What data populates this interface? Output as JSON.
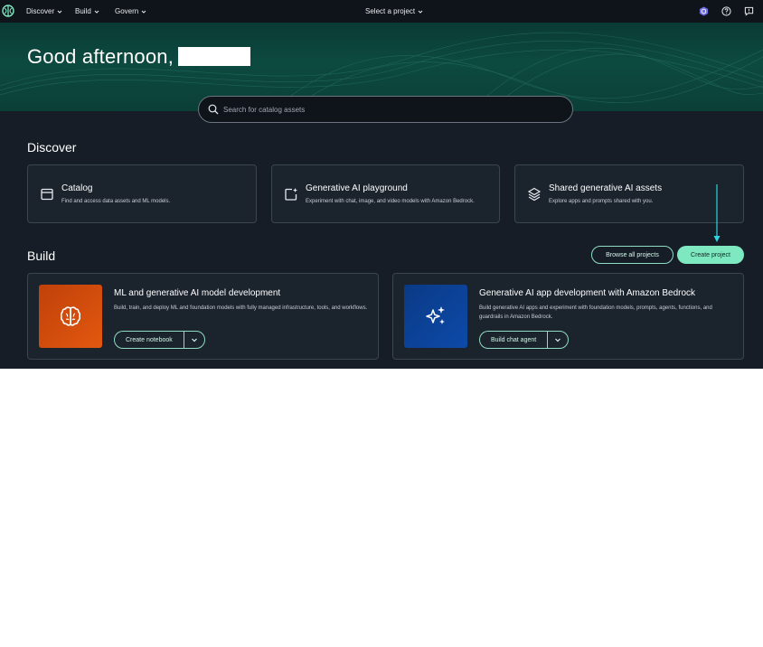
{
  "topbar": {
    "nav": [
      {
        "label": "Discover"
      },
      {
        "label": "Build"
      },
      {
        "label": "Govern"
      }
    ],
    "project_selector": "Select a project",
    "icons": [
      "app-logo-icon",
      "user-badge-icon",
      "help-icon",
      "feedback-icon"
    ]
  },
  "hero": {
    "greeting": "Good afternoon,"
  },
  "search": {
    "placeholder": "Search for catalog assets"
  },
  "discover": {
    "title": "Discover",
    "cards": [
      {
        "icon": "catalog-icon",
        "title": "Catalog",
        "description": "Find and access data assets and ML models."
      },
      {
        "icon": "playground-icon",
        "title": "Generative AI playground",
        "description": "Experiment with chat, image, and video models with Amazon Bedrock."
      },
      {
        "icon": "layers-icon",
        "title": "Shared generative AI assets",
        "description": "Explore apps and prompts shared with you."
      }
    ]
  },
  "build": {
    "title": "Build",
    "browse_label": "Browse all projects",
    "create_label": "Create project",
    "cards": [
      {
        "icon": "brain-icon",
        "title": "ML and generative AI model development",
        "description": "Build, train, and deploy ML and foundation models with fully managed infrastructure, tools, and workflows.",
        "button": "Create notebook",
        "tile_color": "#c8460c"
      },
      {
        "icon": "sparkles-icon",
        "title": "Generative AI app development with Amazon Bedrock",
        "description": "Build generative AI apps and experiment with foundation models, prompts, agents, functions, and guardrails in Amazon Bedrock.",
        "button": "Build chat agent",
        "tile_color": "#0b3f8c"
      }
    ]
  },
  "colors": {
    "background": "#161d26",
    "topbar": "#0f141a",
    "accent": "#7ee8c0",
    "annotation_arrow": "#2fd3e0"
  }
}
